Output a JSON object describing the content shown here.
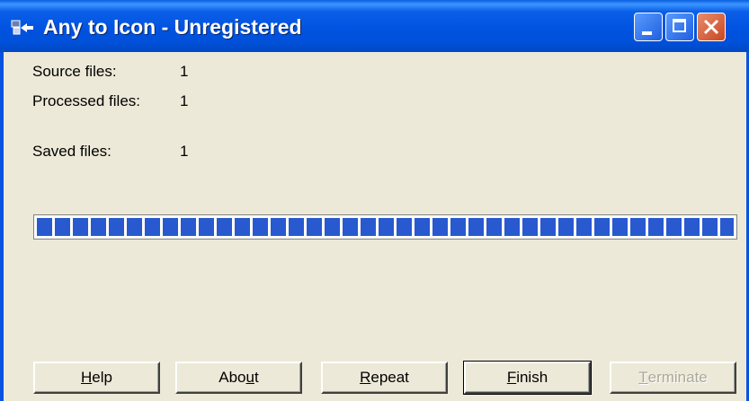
{
  "window": {
    "title": "Any to Icon - Unregistered",
    "controls": {
      "minimize": "minimize-icon",
      "maximize": "maximize-icon",
      "close": "close-icon"
    }
  },
  "stats": {
    "source_label": "Source files:",
    "source_value": "1",
    "processed_label": "Processed files:",
    "processed_value": "1",
    "saved_label": "Saved files:",
    "saved_value": "1"
  },
  "progress": {
    "fraction": 1.0
  },
  "buttons": {
    "help": {
      "pre": "",
      "acc": "H",
      "post": "elp"
    },
    "about": {
      "pre": "Abo",
      "acc": "u",
      "post": "t"
    },
    "repeat": {
      "pre": "",
      "acc": "R",
      "post": "epeat"
    },
    "finish": {
      "pre": "",
      "acc": "F",
      "post": "inish"
    },
    "terminate": {
      "pre": "",
      "acc": "T",
      "post": "erminate"
    }
  },
  "colors": {
    "titlebar": "#0053e0",
    "progress": "#2859cf",
    "background": "#ece9d8"
  }
}
